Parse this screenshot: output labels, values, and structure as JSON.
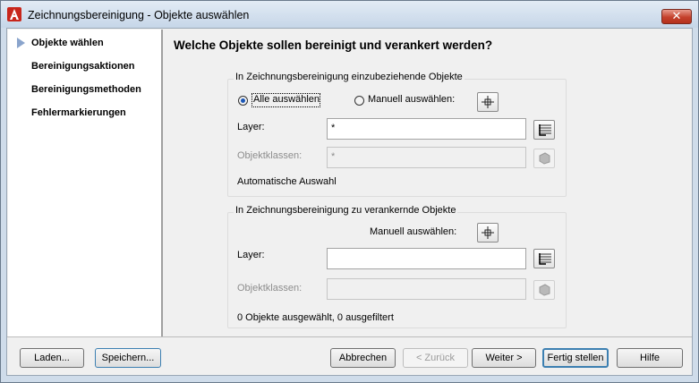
{
  "window": {
    "title": "Zeichnungsbereinigung - Objekte auswählen",
    "close_symbol": "✕"
  },
  "nav": {
    "items": [
      {
        "label": "Objekte wählen",
        "active": true
      },
      {
        "label": "Bereinigungsaktionen",
        "active": false
      },
      {
        "label": "Bereinigungsmethoden",
        "active": false
      },
      {
        "label": "Fehlermarkierungen",
        "active": false
      }
    ]
  },
  "main": {
    "heading": "Welche Objekte sollen bereinigt und verankert werden?",
    "group1": {
      "title": "In Zeichnungsbereinigung einzubeziehende Objekte",
      "radio_all_label": "Alle auswählen",
      "radio_manual_label": "Manuell auswählen:",
      "selected_radio": "all",
      "layer_label": "Layer:",
      "layer_value": "*",
      "classes_label": "Objektklassen:",
      "classes_value": "*",
      "auto_text": "Automatische Auswahl"
    },
    "group2": {
      "title": "In Zeichnungsbereinigung zu verankernde Objekte",
      "manual_label": "Manuell auswählen:",
      "layer_label": "Layer:",
      "layer_value": "",
      "classes_label": "Objektklassen:",
      "classes_value": "",
      "status_text": "0 Objekte ausgewählt, 0 ausgefiltert"
    }
  },
  "footer": {
    "load": "Laden...",
    "save": "Speichern...",
    "cancel": "Abbrechen",
    "back": "< Zurück",
    "next": "Weiter >",
    "finish": "Fertig stellen",
    "help": "Hilfe"
  },
  "icons": {
    "app": "autocad-a-icon",
    "pick": "pick-point-icon",
    "layer": "layer-select-icon",
    "class": "object-class-icon"
  },
  "colors": {
    "title_bar": "#c6d6e8",
    "close_button": "#c4412c",
    "nav_arrow": "#8aa4cc",
    "default_button_border": "#3c7fb1"
  }
}
